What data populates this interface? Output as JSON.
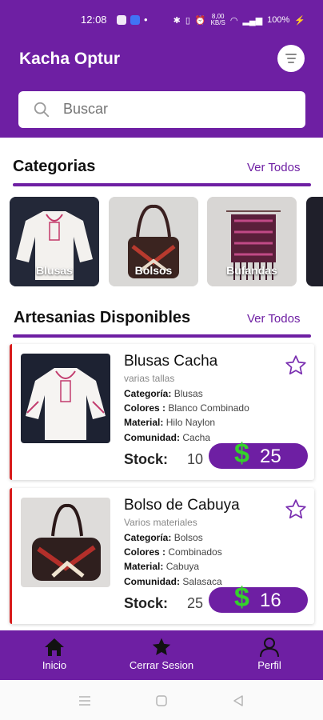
{
  "status_bar": {
    "time": "12:08",
    "battery": "100%",
    "net_speed_top": "8,00",
    "net_speed_bottom": "KB/S"
  },
  "header": {
    "title": "Kacha Optur"
  },
  "search": {
    "placeholder": "Buscar"
  },
  "categories": {
    "title": "Categorias",
    "see_all": "Ver Todos",
    "items": [
      {
        "label": "Blusas"
      },
      {
        "label": "Bolsos"
      },
      {
        "label": "Bufandas"
      }
    ]
  },
  "products": {
    "title": "Artesanias Disponibles",
    "see_all": "Ver Todos",
    "items": [
      {
        "name": "Blusas Cacha",
        "subtitle": "varias tallas",
        "category_label": "Categoría:",
        "category": "Blusas",
        "colors_label": "Colores :",
        "colors": "Blanco Combinado",
        "material_label": "Material:",
        "material": "Hilo Naylon",
        "community_label": "Comunidad:",
        "community": "Cacha",
        "stock_label": "Stock:",
        "stock": "10",
        "currency": "$",
        "price": "25"
      },
      {
        "name": "Bolso de Cabuya",
        "subtitle": "Varios materiales",
        "category_label": "Categoría:",
        "category": "Bolsos",
        "colors_label": "Colores :",
        "colors": "Combinados",
        "material_label": "Material:",
        "material": "Cabuya",
        "community_label": "Comunidad:",
        "community": "Salasaca",
        "stock_label": "Stock:",
        "stock": "25",
        "currency": "$",
        "price": "16"
      }
    ]
  },
  "bottom_nav": {
    "items": [
      {
        "label": "Inicio",
        "icon": "home-icon"
      },
      {
        "label": "Cerrar Sesion",
        "icon": "star-icon"
      },
      {
        "label": "Perfil",
        "icon": "person-icon"
      }
    ]
  },
  "colors": {
    "primary": "#6e1fa3",
    "accent_green": "#34d12b",
    "card_border": "#d81b1b"
  }
}
